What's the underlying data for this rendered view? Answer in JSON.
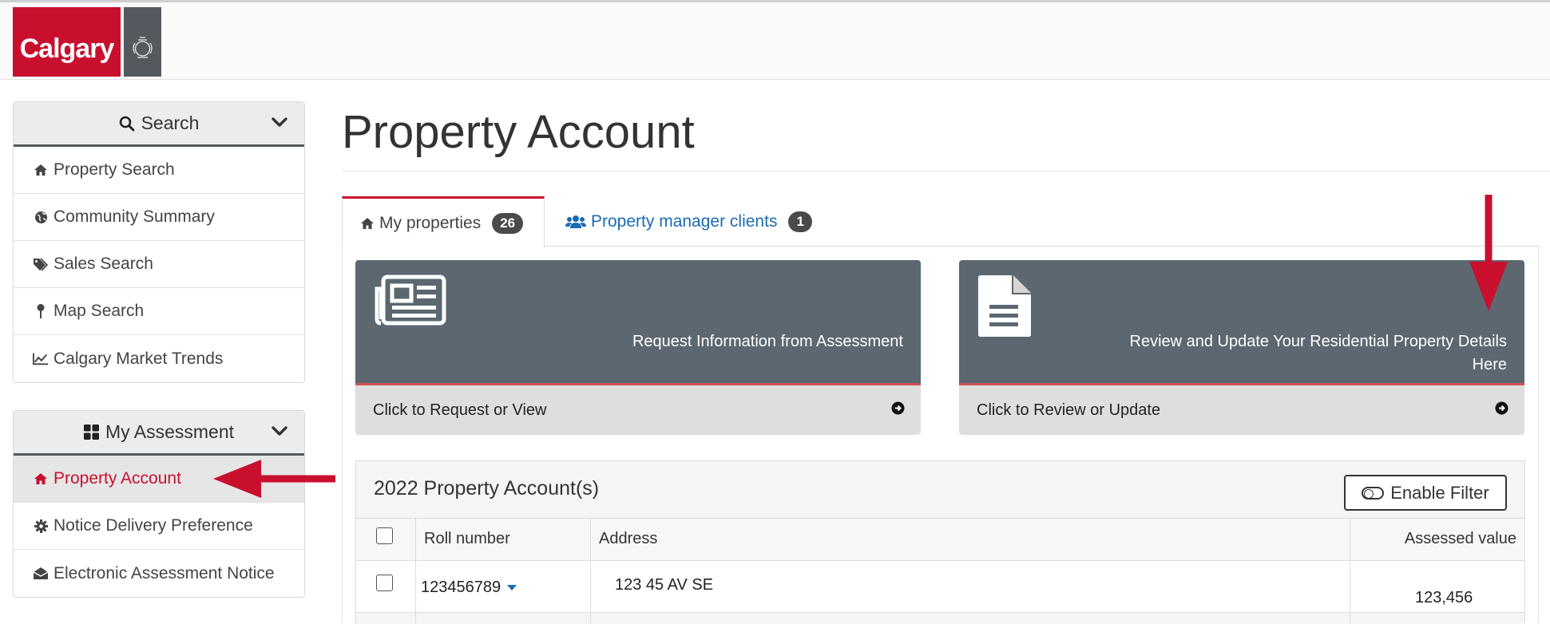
{
  "header": {
    "logo_text": "Calgary"
  },
  "sidebar": {
    "search_panel": {
      "title": "Search",
      "items": [
        {
          "label": "Property Search",
          "icon": "home-icon"
        },
        {
          "label": "Community Summary",
          "icon": "globe-icon"
        },
        {
          "label": "Sales Search",
          "icon": "tags-icon"
        },
        {
          "label": "Map Search",
          "icon": "map-pin-icon"
        },
        {
          "label": "Calgary Market Trends",
          "icon": "line-chart-icon"
        }
      ]
    },
    "assessment_panel": {
      "title": "My Assessment",
      "items": [
        {
          "label": "Property Account",
          "icon": "home-icon",
          "active": true
        },
        {
          "label": "Notice Delivery Preference",
          "icon": "gear-icon"
        },
        {
          "label": "Electronic Assessment Notice",
          "icon": "envelope-open-icon"
        }
      ]
    }
  },
  "main": {
    "page_title": "Property Account",
    "tabs": [
      {
        "label": "My properties",
        "count": "26",
        "active": true
      },
      {
        "label": "Property manager clients",
        "count": "1",
        "active": false
      }
    ],
    "cards": [
      {
        "title": "Request Information from Assessment",
        "action": "Click to Request or View",
        "icon": "newspaper-icon"
      },
      {
        "title": "Review and Update Your Residential Property Details Here",
        "action": "Click to Review or Update",
        "icon": "document-icon"
      }
    ],
    "table": {
      "title": "2022 Property Account(s)",
      "filter_button": "Enable Filter",
      "columns": [
        "Roll number",
        "Address",
        "Assessed value"
      ],
      "rows": [
        {
          "roll_number": "123456789",
          "address": "123 45 AV SE",
          "assessed_value": "123,456"
        }
      ]
    }
  },
  "colors": {
    "brand_red": "#c8102e",
    "card_dark": "#5c6770",
    "link_blue": "#1a6bb4",
    "annotation_arrow": "#c8102e"
  }
}
